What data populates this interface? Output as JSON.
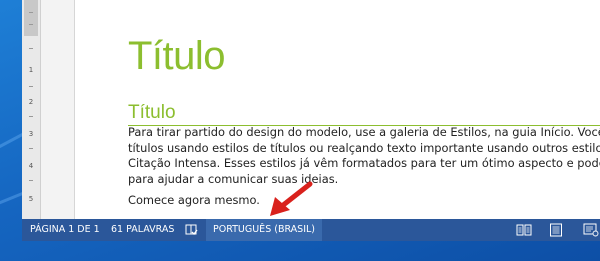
{
  "document": {
    "title": "Título",
    "heading": "Título",
    "paragraph_lines": [
      "Para tirar partido do design do modelo, use a galeria de Estilos, na guia Início. Você pode formatar",
      "títulos usando estilos de títulos ou realçando texto importante usando outros estilos, como",
      "Citação Intensa. Esses estilos já vêm formatados para ter um ótimo aspecto e podem ser combinados",
      "para ajudar a comunicar suas ideias."
    ],
    "second_paragraph": "Comece agora mesmo."
  },
  "ruler": {
    "numbers": [
      "1",
      "2",
      "3",
      "4",
      "5"
    ]
  },
  "statusbar": {
    "page_info": "PÁGINA 1 DE 1",
    "word_count": "61 PALAVRAS",
    "proofing_icon": "proofing-book-icon",
    "language": "PORTUGUÊS (BRASIL)",
    "view_icons": [
      "read-mode-icon",
      "print-layout-icon",
      "web-layout-icon"
    ]
  },
  "colors": {
    "title_green": "#8cbe2f",
    "statusbar_blue": "#2b579a",
    "arrow_red": "#d9211c",
    "desktop_blue": "#1565c0"
  }
}
